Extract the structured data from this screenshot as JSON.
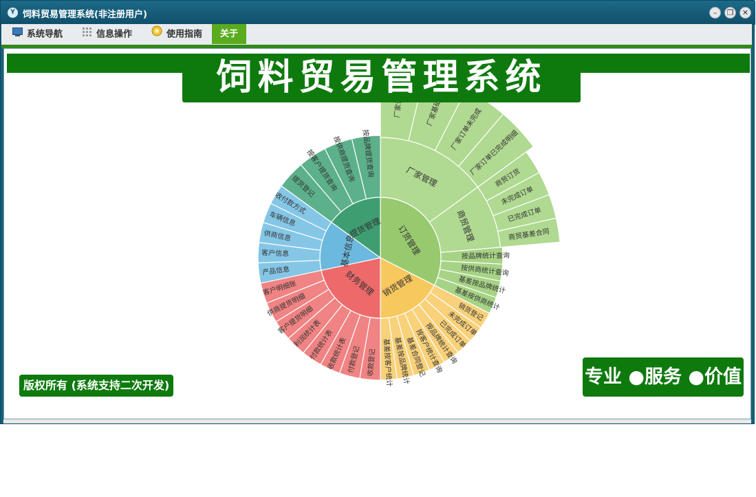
{
  "window": {
    "title": "饲料贸易管理系统(非注册用户)",
    "icon": "app-logo-icon",
    "controls": [
      "minimize-icon",
      "restore-icon",
      "close-icon"
    ]
  },
  "menu": {
    "items": [
      {
        "label": "系统导航",
        "icon": "monitor-icon"
      },
      {
        "label": "信息操作",
        "icon": "grid-icon"
      },
      {
        "label": "使用指南",
        "icon": "bulb-icon"
      },
      {
        "label": "关于",
        "icon": ""
      }
    ],
    "active": "关于"
  },
  "banner": {
    "title": "饲料贸易管理系统"
  },
  "copyright": "版权所有 (系统支持二次开发)",
  "slogan": "专业 ●服务 ●价值",
  "chart_data": {
    "type": "sunburst",
    "categories": [
      {
        "name": "订货管理",
        "color": "#98c96f",
        "children": [
          {
            "name": "厂家管理",
            "color": "#b0d991",
            "children": [
              "厂家订货",
              "厂家基础",
              "厂家订单未完成",
              "厂家订单已完成明细"
            ]
          },
          {
            "name": "商贸管理",
            "color": "#b0d991",
            "children": [
              "商贸订货",
              "未完成订单",
              "已完成订单",
              "商贸基差合同"
            ]
          },
          {
            "name": "",
            "color": "#a6d385",
            "children": [
              "按品牌统计查询",
              "按供商统计查询",
              "基差按品牌统计",
              "基差按供商统计"
            ]
          }
        ]
      },
      {
        "name": "销货管理",
        "color": "#f7c85e",
        "children": [
          {
            "name": "",
            "color": "#f8d17a",
            "children": [
              "销货登记",
              "未完成订单",
              "已完成订单",
              "按品牌统计查询",
              "按客户统计查询",
              "基差合同登记",
              "基差按品牌统计",
              "基差按客户统计"
            ]
          }
        ]
      },
      {
        "name": "财务管理",
        "color": "#ee6a6a",
        "children": [
          {
            "name": "",
            "color": "#f08383",
            "children": [
              "收款登记",
              "付款登记",
              "收款统计表",
              "付款统计表",
              "利润统计表",
              "客户提货明细",
              "供商提货明细",
              "客户明细账"
            ]
          }
        ]
      },
      {
        "name": "基本信息",
        "color": "#6bb9df",
        "children": [
          {
            "name": "",
            "color": "#85c6e6",
            "children": [
              "产品信息",
              "客户信息",
              "供商信息",
              "车辆信息",
              "收付款方式"
            ]
          }
        ]
      },
      {
        "name": "提货管理",
        "color": "#3e9e71",
        "children": [
          {
            "name": "",
            "color": "#5cb08a",
            "children": [
              "提货登记",
              "按客户提货查询",
              "按供商提货查询",
              "按品牌提货查询"
            ]
          }
        ]
      }
    ]
  }
}
